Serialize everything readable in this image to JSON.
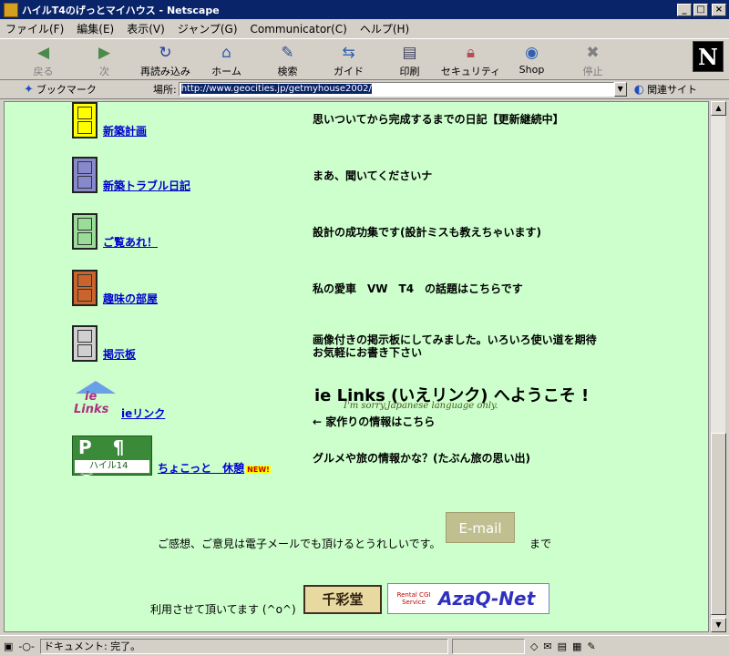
{
  "window": {
    "title": "ハイルT4のげっとマイハウス - Netscape"
  },
  "menu": [
    "ファイル(F)",
    "編集(E)",
    "表示(V)",
    "ジャンプ(G)",
    "Communicator(C)",
    "ヘルプ(H)"
  ],
  "toolbar": {
    "back": "戻る",
    "forward": "次",
    "reload": "再読み込み",
    "home": "ホーム",
    "search": "検索",
    "guide": "ガイド",
    "print": "印刷",
    "security": "セキュリティ",
    "shop": "Shop",
    "stop": "停止"
  },
  "logo": "N",
  "location": {
    "bookmarks": "ブックマーク",
    "label": "場所:",
    "url": "http://www.geocities.jp/getmyhouse2002/",
    "related": "関連サイト"
  },
  "page": {
    "items": [
      {
        "link": "新築計画",
        "desc": "思いついてから完成するまでの日記【更新継続中】"
      },
      {
        "link": "新築トラブル日記",
        "desc": "まあ、聞いてくださいナ"
      },
      {
        "link": "ご覧あれ！",
        "desc": "設計の成功集です(設計ミスも教えちゃいます)"
      },
      {
        "link": "趣味の部屋",
        "desc": "私の愛車　VW　T4　の話題はこちらです"
      },
      {
        "link": "掲示板",
        "desc_line1": "画像付きの掲示板にしてみました。いろいろ使い道を期待",
        "desc_line2": "お気軽にお書き下さい"
      }
    ],
    "ie": {
      "logo_line1": "ie",
      "logo_line2": "Links",
      "link": "ieリンク",
      "title": "ie Links (いえリンク) へようこそ !",
      "subtitle": "I'm sorry,Japanese language only.",
      "arrow_text": "← 家作りの情報はこちら"
    },
    "rest": {
      "sign_top": "P ¶ ☕",
      "sign_bottom": "ハイル14",
      "link": "ちょこっと　休憩",
      "badge": "NEW!",
      "desc": "グルメや旅の情報かな？(たぶん旅の思い出)"
    },
    "feedback": "ご感想、ご意見は電子メールでも頂けるとうれしいです。",
    "email_button": "E-mail",
    "made": "まで",
    "usage": "利用させて頂いてます (^o^)",
    "chisai": "千彩堂",
    "azaq_small": "Rental CGI Service",
    "azaq_big": "AzaQ-Net"
  },
  "status": {
    "text": "ドキュメント: 完了。"
  },
  "colors": {
    "page_bg": "#ccffcc",
    "cabinet_yellow": "#ffff00",
    "cabinet_blue": "#8888cc",
    "cabinet_green": "#99dd99",
    "cabinet_brown": "#c8642c",
    "cabinet_gray": "#d0d0d0"
  }
}
